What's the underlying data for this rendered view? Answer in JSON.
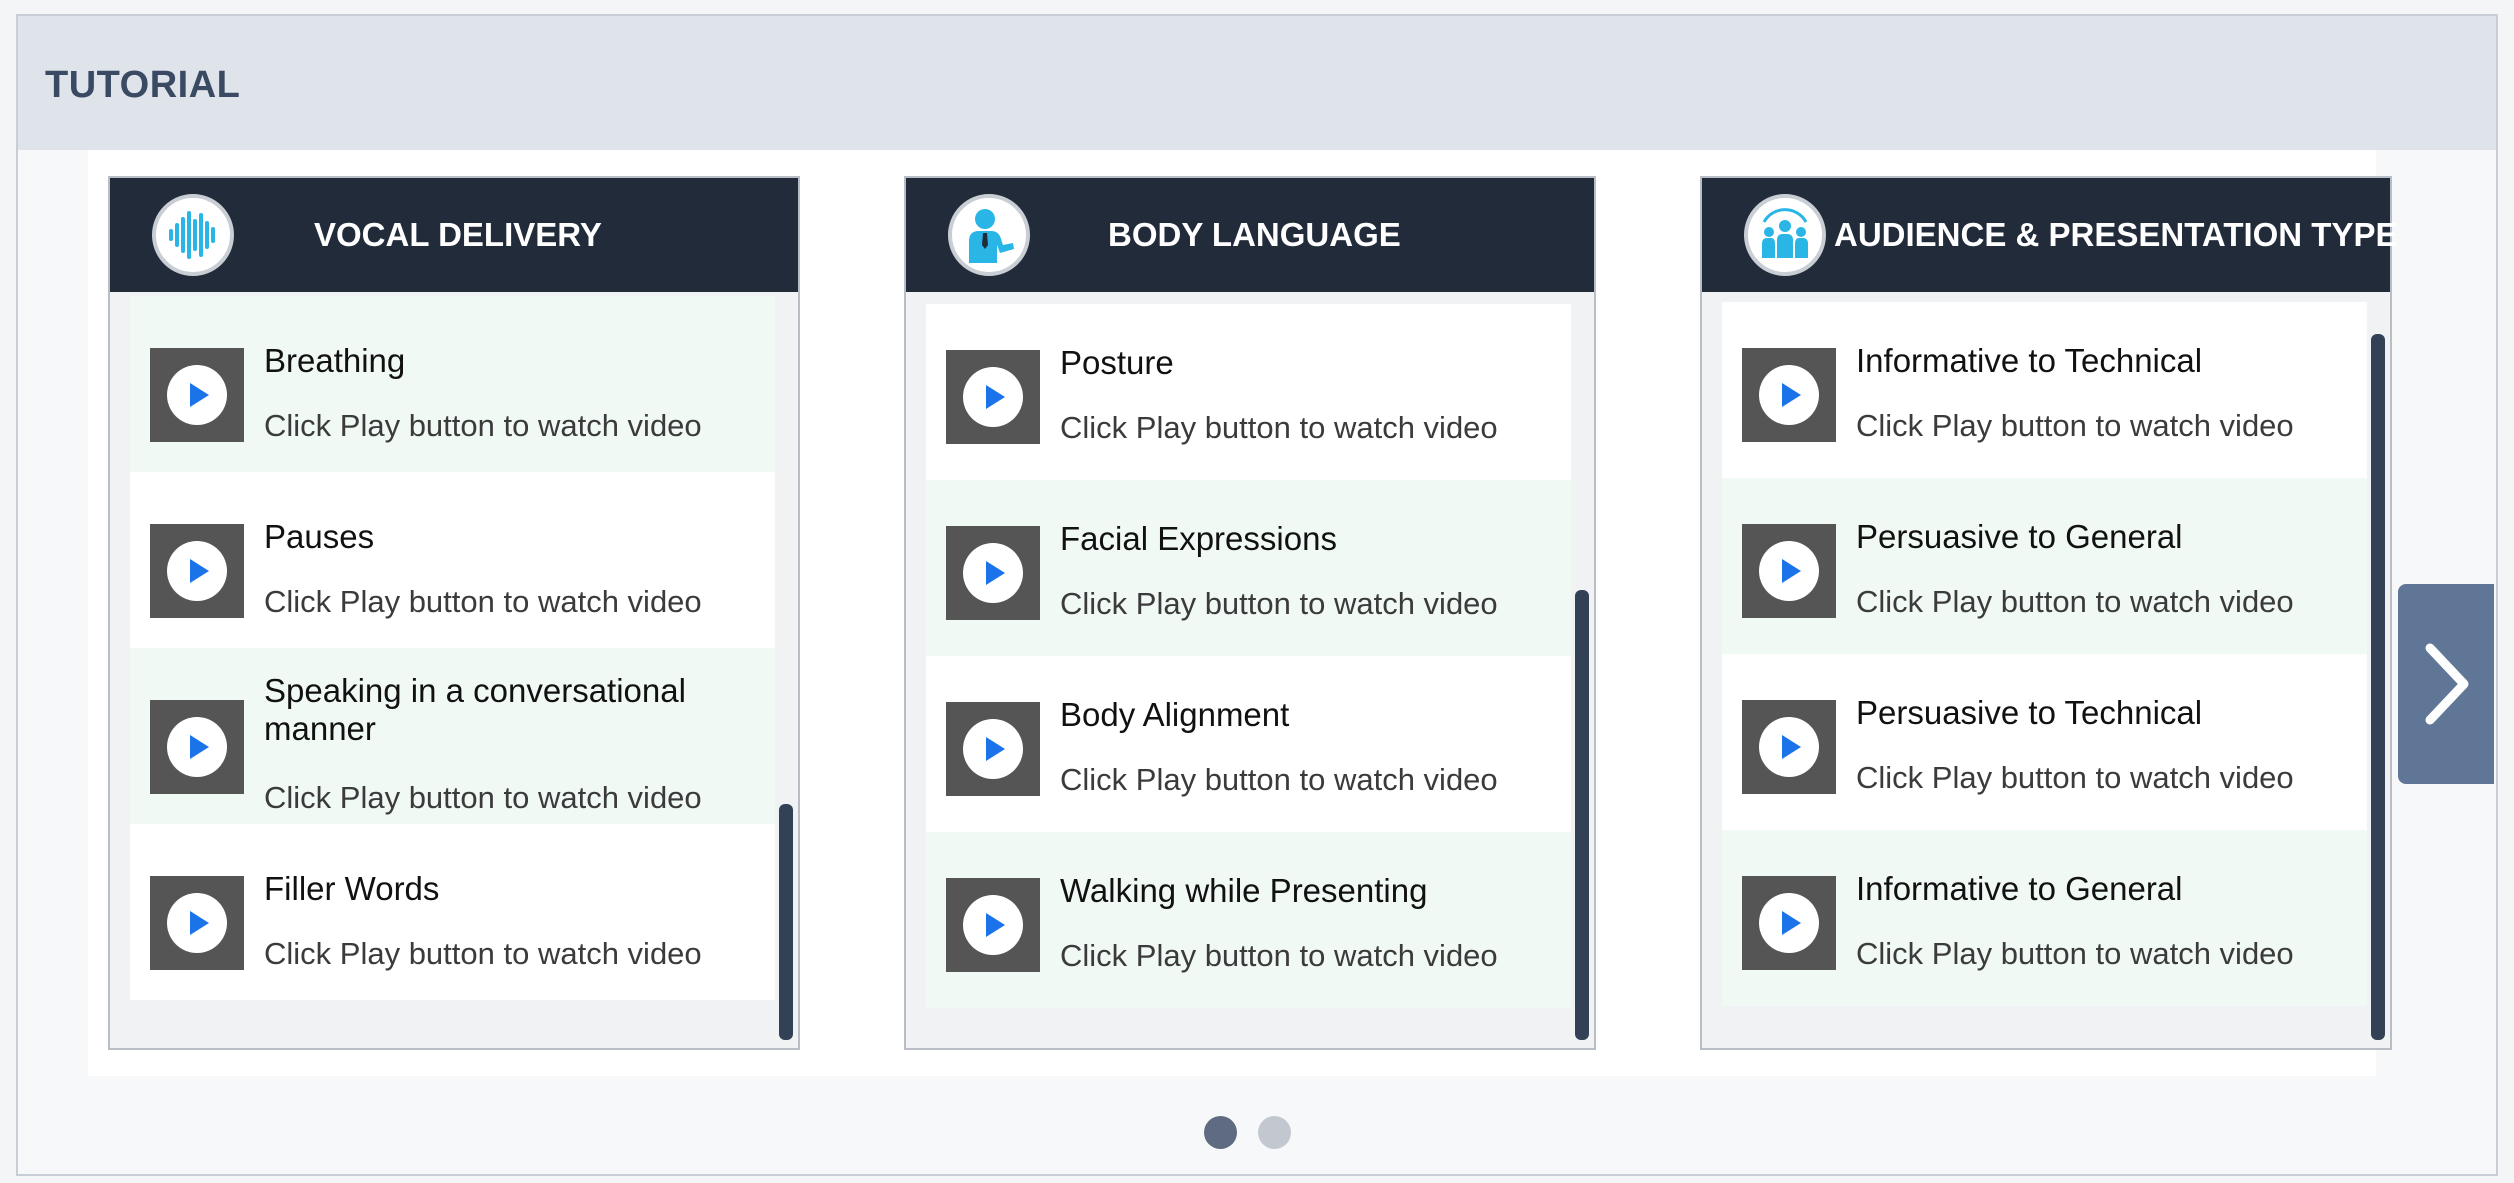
{
  "page": {
    "title": "TUTORIAL"
  },
  "colors": {
    "header_bg": "#dfe3ea",
    "card_header_bg": "#222b3a",
    "accent_blue": "#1a73e8",
    "icon_cyan": "#29b6e6",
    "scrollbar": "#324156",
    "next_button": "#5f7696",
    "dot_active": "#5e6b80",
    "dot_inactive": "#c3c8d0"
  },
  "cards": [
    {
      "title": "VOCAL DELIVERY",
      "icon": "soundwave-icon",
      "items": [
        {
          "title": "Breathing",
          "subtitle": "Click Play button to watch video"
        },
        {
          "title": "Pauses",
          "subtitle": "Click Play button to watch video"
        },
        {
          "title": "Speaking in a conversational manner",
          "subtitle": "Click Play button to watch video"
        },
        {
          "title": "Filler Words",
          "subtitle": "Click Play button to watch video"
        }
      ]
    },
    {
      "title": "BODY LANGUAGE",
      "icon": "presenter-icon",
      "items": [
        {
          "title": "Posture",
          "subtitle": "Click Play button to watch video"
        },
        {
          "title": "Facial Expressions",
          "subtitle": "Click Play button to watch video"
        },
        {
          "title": "Body Alignment",
          "subtitle": "Click Play button to watch video"
        },
        {
          "title": "Walking while Presenting",
          "subtitle": "Click Play button to watch video"
        }
      ]
    },
    {
      "title": "AUDIENCE & PRESENTATION TYPE",
      "icon": "audience-icon",
      "items": [
        {
          "title": "Informative to Technical",
          "subtitle": "Click Play button to watch video"
        },
        {
          "title": "Persuasive to General",
          "subtitle": "Click Play button to watch video"
        },
        {
          "title": "Persuasive to Technical",
          "subtitle": "Click Play button to watch video"
        },
        {
          "title": "Informative to General",
          "subtitle": "Click Play button to watch video"
        }
      ]
    }
  ],
  "carousel": {
    "pages": 2,
    "current_page": 1,
    "next_icon": "chevron-right-icon"
  }
}
